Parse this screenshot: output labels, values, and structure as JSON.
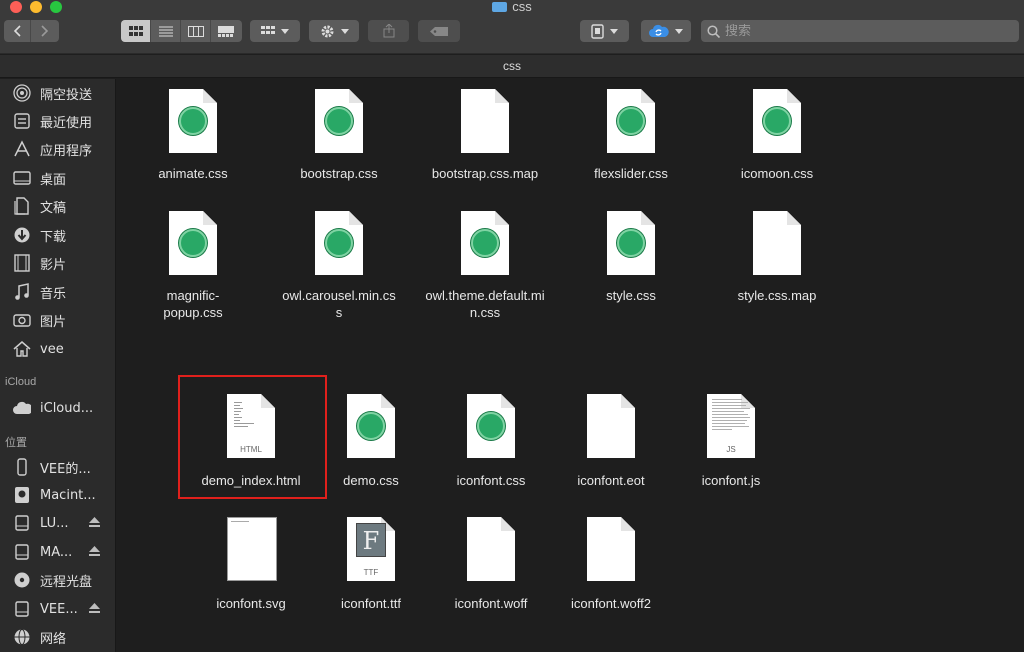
{
  "window": {
    "title": "css"
  },
  "toolbar": {
    "view_modes": [
      "icon-view",
      "list-view",
      "column-view",
      "gallery-view"
    ],
    "search_placeholder": "搜索"
  },
  "pathbar": {
    "label": "css"
  },
  "sidebar": {
    "favorites": [
      {
        "label": "隔空投送",
        "icon": "airdrop-icon"
      },
      {
        "label": "最近使用",
        "icon": "recents-icon"
      },
      {
        "label": "应用程序",
        "icon": "applications-icon"
      },
      {
        "label": "桌面",
        "icon": "desktop-icon"
      },
      {
        "label": "文稿",
        "icon": "documents-icon"
      },
      {
        "label": "下载",
        "icon": "downloads-icon"
      },
      {
        "label": "影片",
        "icon": "movies-icon"
      },
      {
        "label": "音乐",
        "icon": "music-icon"
      },
      {
        "label": "图片",
        "icon": "pictures-icon"
      },
      {
        "label": "vee",
        "icon": "home-icon"
      }
    ],
    "icloud_header": "iCloud",
    "icloud": [
      {
        "label": "iCloud...",
        "icon": "cloud-icon"
      }
    ],
    "locations_header": "位置",
    "locations": [
      {
        "label": "VEE的...",
        "icon": "iphone-icon",
        "eject": false
      },
      {
        "label": "Macint...",
        "icon": "harddisk-icon",
        "eject": false
      },
      {
        "label": "LU...",
        "icon": "drive-icon",
        "eject": true
      },
      {
        "label": "MA...",
        "icon": "drive-icon",
        "eject": true
      },
      {
        "label": "远程光盘",
        "icon": "disc-icon",
        "eject": false
      },
      {
        "label": "VEE...",
        "icon": "drive-icon",
        "eject": true
      },
      {
        "label": "网络",
        "icon": "network-icon",
        "eject": false
      }
    ]
  },
  "files": [
    {
      "name": "animate.css",
      "type": "atom"
    },
    {
      "name": "bootstrap.css",
      "type": "atom"
    },
    {
      "name": "bootstrap.css.map",
      "type": "blank"
    },
    {
      "name": "flexslider.css",
      "type": "atom"
    },
    {
      "name": "icomoon.css",
      "type": "atom"
    },
    {
      "name": "magnific-popup.css",
      "type": "atom"
    },
    {
      "name": "owl.carousel.min.css",
      "type": "atom"
    },
    {
      "name": "owl.theme.default.min.css",
      "type": "atom"
    },
    {
      "name": "style.css",
      "type": "atom"
    },
    {
      "name": "style.css.map",
      "type": "blank"
    },
    {
      "name": "demo_index.html",
      "type": "html",
      "label": "HTML"
    },
    {
      "name": "demo.css",
      "type": "atom"
    },
    {
      "name": "iconfont.css",
      "type": "atom"
    },
    {
      "name": "iconfont.eot",
      "type": "blank"
    },
    {
      "name": "iconfont.js",
      "type": "js",
      "label": "JS"
    },
    {
      "name": "iconfont.svg",
      "type": "svg"
    },
    {
      "name": "iconfont.ttf",
      "type": "ttf",
      "label": "TTF",
      "glyph": "F"
    },
    {
      "name": "iconfont.woff",
      "type": "blank"
    },
    {
      "name": "iconfont.woff2",
      "type": "blank"
    }
  ],
  "colors": {
    "selection_border": "#e0201c",
    "atom_green": "#29a866",
    "folder_blue": "#5ea7e4"
  }
}
